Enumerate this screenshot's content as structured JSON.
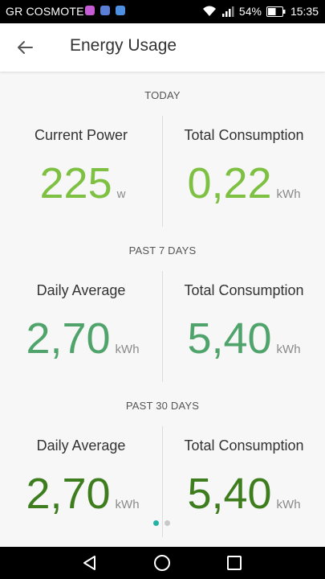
{
  "status_bar": {
    "carrier": "GR COSMOTE",
    "battery_percent": "54%",
    "time": "15:35",
    "icons": [
      "instagram-notification-icon",
      "app-notification-icon",
      "message-notification-icon",
      "wifi-icon",
      "signal-icon",
      "battery-icon"
    ]
  },
  "app_bar": {
    "title": "Energy Usage",
    "back_icon": "arrow-back-icon"
  },
  "sections": [
    {
      "title": "TODAY",
      "color": "#7ec142",
      "left": {
        "label": "Current Power",
        "value": "225",
        "unit": "w"
      },
      "right": {
        "label": "Total Consumption",
        "value": "0,22",
        "unit": "kWh"
      }
    },
    {
      "title": "PAST 7 DAYS",
      "color": "#4fa36b",
      "left": {
        "label": "Daily Average",
        "value": "2,70",
        "unit": "kWh"
      },
      "right": {
        "label": "Total Consumption",
        "value": "5,40",
        "unit": "kWh"
      }
    },
    {
      "title": "PAST 30 DAYS",
      "color": "#3e7d1e",
      "left": {
        "label": "Daily Average",
        "value": "2,70",
        "unit": "kWh"
      },
      "right": {
        "label": "Total Consumption",
        "value": "5,40",
        "unit": "kWh"
      }
    }
  ],
  "page_indicator": {
    "pages": 2,
    "active": 1,
    "active_color": "#25b3a6",
    "inactive_color": "#c8c8c8"
  },
  "nav_bar": {
    "icons": [
      "back-triangle-icon",
      "home-circle-icon",
      "recents-square-icon"
    ]
  }
}
